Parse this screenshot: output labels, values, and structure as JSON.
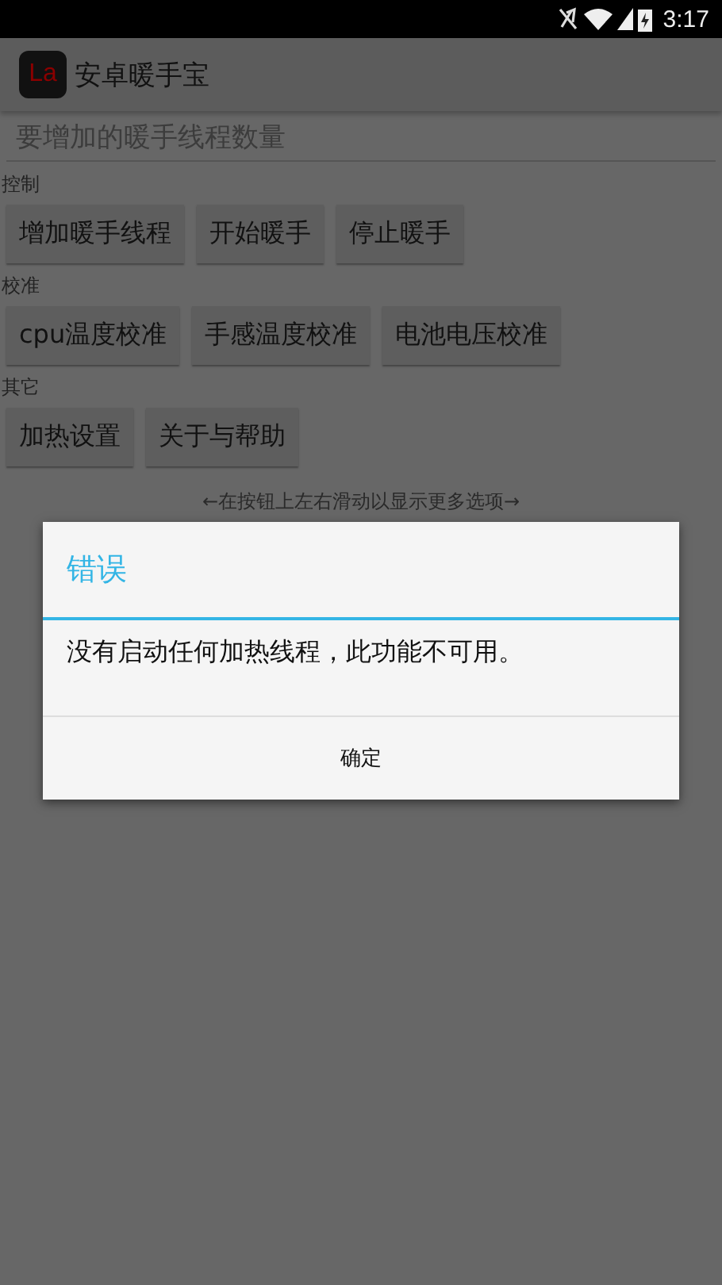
{
  "status_bar": {
    "time": "3:17"
  },
  "app_bar": {
    "icon_text": "La",
    "title": "安卓暖手宝"
  },
  "input": {
    "placeholder": "要增加的暖手线程数量"
  },
  "sections": [
    {
      "label": "控制",
      "buttons": [
        "增加暖手线程",
        "开始暖手",
        "停止暖手"
      ]
    },
    {
      "label": "校准",
      "buttons": [
        "cpu温度校准",
        "手感温度校准",
        "电池电压校准"
      ]
    },
    {
      "label": "其它",
      "buttons": [
        "加热设置",
        "关于与帮助"
      ]
    }
  ],
  "hint": "←在按钮上左右滑动以显示更多选项→",
  "dialog": {
    "title": "错误",
    "message": "没有启动任何加热线程，此功能不可用。",
    "button": "确定"
  }
}
